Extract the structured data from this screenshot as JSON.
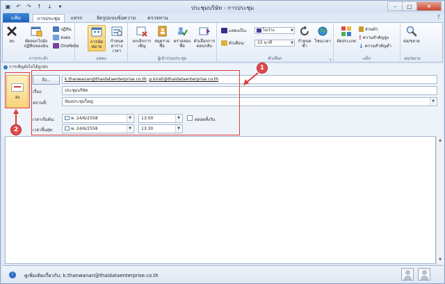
{
  "window": {
    "title": "ประชุมบริษัท - การประชุม",
    "controls": {
      "minimize": "–",
      "maximize": "□",
      "close": "✕"
    }
  },
  "quick_access": {
    "save": "▣",
    "undo": "↶",
    "redo": "↷",
    "up": "↑",
    "down": "↓",
    "more": "▾"
  },
  "tabs": {
    "file": "แฟ้ม",
    "items": [
      "การประชุม",
      "แทรก",
      "จัดรูปแบบข้อความ",
      "ตรวจทาน"
    ],
    "active_index": 0,
    "help": "?"
  },
  "ribbon": {
    "actions": {
      "label": "การกระทำ",
      "delete": "ลบ",
      "copy_to_calendar": "คัดลอกไปยังปฏิทินของฉัน",
      "calendar": "ปฏิทิน",
      "forward": "ส่งต่อ",
      "onenote": "OneNote"
    },
    "show": {
      "label": "แสดง",
      "appointment": "การนัดหมาย",
      "scheduling": "กำหนดตารางเวลา"
    },
    "attendees": {
      "label": "ผู้เข้าร่วมประชุม",
      "cancel_invitation": "ยกเลิกการเชิญ",
      "address_book": "สมุดรายชื่อ",
      "check_names": "ตรวจสอบชื่อ",
      "response_options": "ตัวเลือกการตอบกลับ"
    },
    "options": {
      "label": "ตัวเลือก",
      "show_as_label": "แสดงเป็น:",
      "show_as_value": "ไม่ว่าง",
      "reminder_label": "ตัวเตือน:",
      "reminder_value": "15 นาที",
      "recurrence": "กำหนดซ้ำ",
      "time_zones": "โซนเวลา",
      "launcher": "↘"
    },
    "tags": {
      "label": "แท็ก",
      "categorize": "จัดประเภท",
      "private": "ส่วนตัว",
      "high_importance": "ความสำคัญสูง",
      "low_importance": "ความสำคัญต่ำ"
    },
    "zoom": {
      "label": "ย่อ/ขยาย",
      "zoom": "ย่อ/ขยาย"
    }
  },
  "infobar": {
    "icon": "i",
    "text": "การเชิญยังไม่ได้ถูกส่ง"
  },
  "form": {
    "send_label": "ส่ง",
    "to_button": "ถึง...",
    "to_value_1": "k.thanwanan@thaidataenterprise.co.th",
    "to_sep": "; ",
    "to_value_2": "p.kirati@thaidataenterprise.co.th",
    "subject_label": "เรื่อง:",
    "subject_value": "ประชุมบริษัท",
    "location_label": "สถานที่:",
    "location_value": "ห้องประชุมใหญ่",
    "start_label": "เวลาเริ่มต้น:",
    "start_date": "พ. 24/6/2558",
    "start_time": "13:00",
    "end_label": "เวลาสิ้นสุด:",
    "end_date": "พ. 24/6/2558",
    "end_time": "13:30",
    "all_day_label": "ตลอดทั้งวัน"
  },
  "people_pane": {
    "icon": "i",
    "text": "ดูเพิ่มเติมเกี่ยวกับ: k.thanwanan@thaidataenterprise.co.th"
  },
  "annotations": {
    "marker_1": "1",
    "marker_2": "2"
  },
  "colors": {
    "annotation_red": "#e03a3a",
    "send_button": "#f7d37a",
    "file_tab": "#1b5fb8"
  }
}
